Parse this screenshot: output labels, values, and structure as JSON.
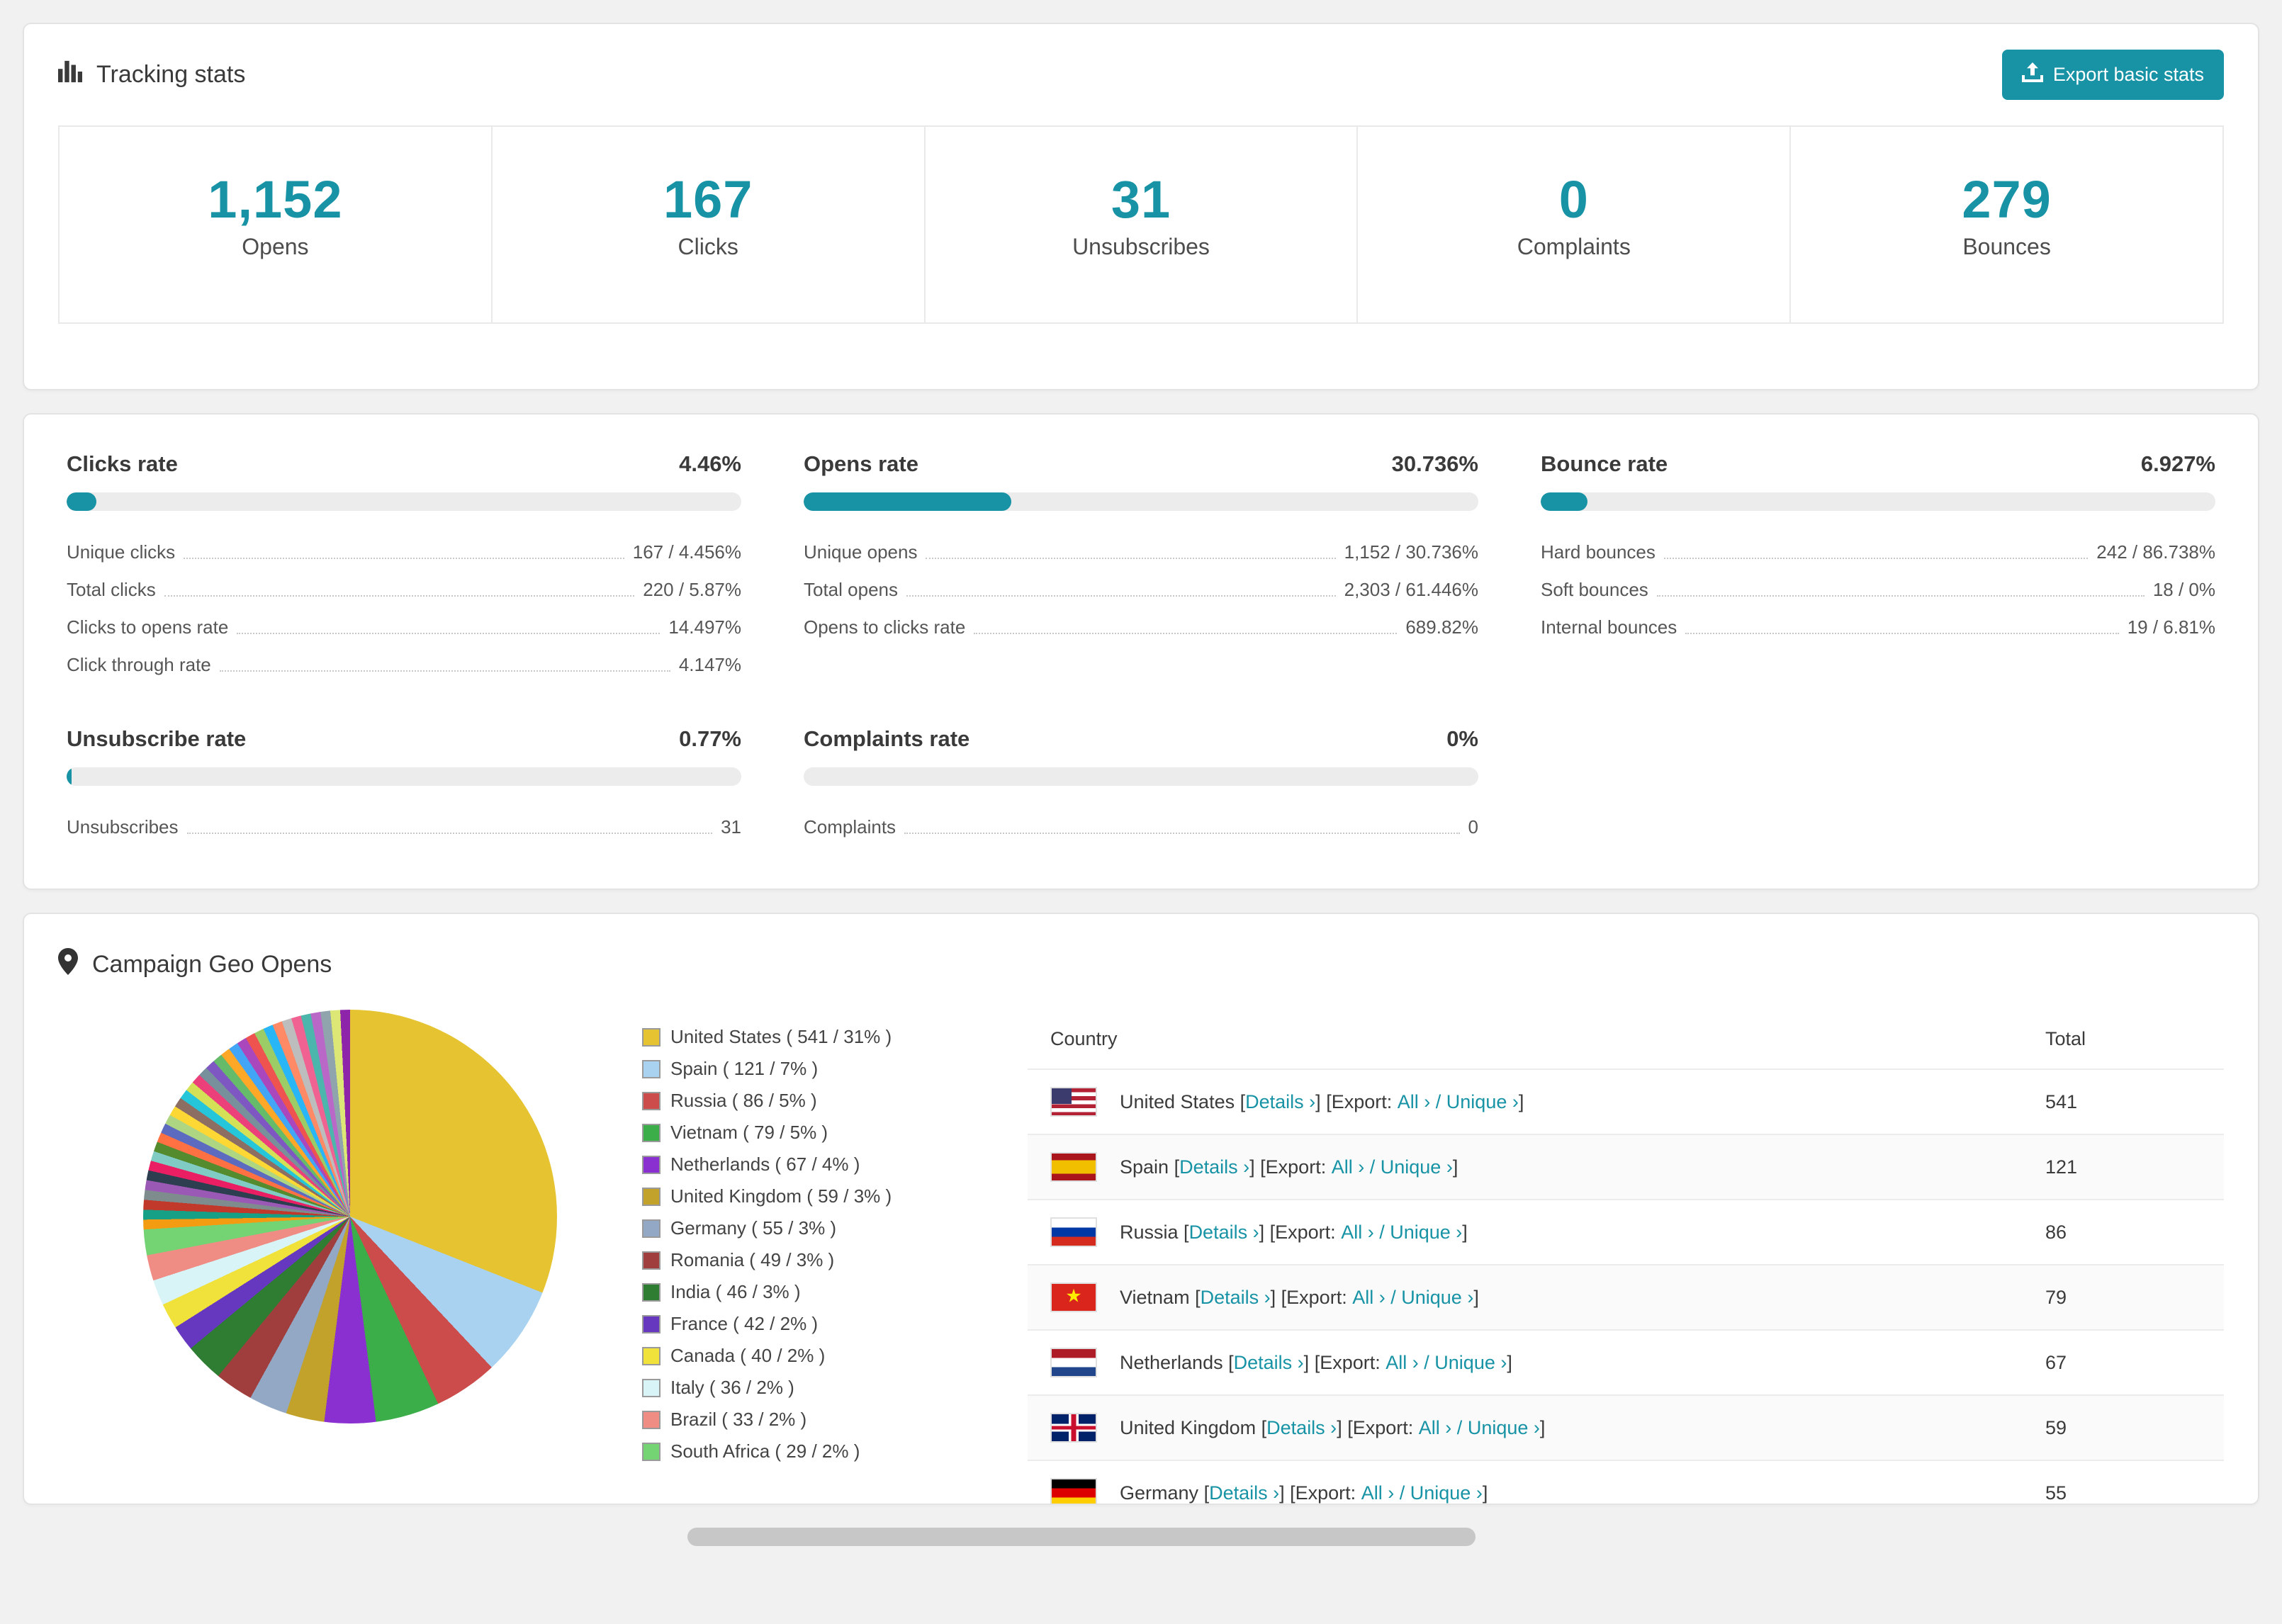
{
  "theme": {
    "accent": "#1793a5"
  },
  "tracking": {
    "title": "Tracking stats",
    "export_button": "Export basic stats",
    "stats": [
      {
        "value": "1,152",
        "label": "Opens"
      },
      {
        "value": "167",
        "label": "Clicks"
      },
      {
        "value": "31",
        "label": "Unsubscribes"
      },
      {
        "value": "0",
        "label": "Complaints"
      },
      {
        "value": "279",
        "label": "Bounces"
      }
    ]
  },
  "rates": [
    {
      "title": "Clicks rate",
      "value": "4.46%",
      "percent": 4.46,
      "rows": [
        {
          "label": "Unique clicks",
          "value": "167 / 4.456%"
        },
        {
          "label": "Total clicks",
          "value": "220 / 5.87%"
        },
        {
          "label": "Clicks to opens rate",
          "value": "14.497%"
        },
        {
          "label": "Click through rate",
          "value": "4.147%"
        }
      ]
    },
    {
      "title": "Opens rate",
      "value": "30.736%",
      "percent": 30.736,
      "rows": [
        {
          "label": "Unique opens",
          "value": "1,152 / 30.736%"
        },
        {
          "label": "Total opens",
          "value": "2,303 / 61.446%"
        },
        {
          "label": "Opens to clicks rate",
          "value": "689.82%"
        }
      ]
    },
    {
      "title": "Bounce rate",
      "value": "6.927%",
      "percent": 6.927,
      "rows": [
        {
          "label": "Hard bounces",
          "value": "242 / 86.738%"
        },
        {
          "label": "Soft bounces",
          "value": "18 / 0%"
        },
        {
          "label": "Internal bounces",
          "value": "19 / 6.81%"
        }
      ]
    },
    {
      "title": "Unsubscribe rate",
      "value": "0.77%",
      "percent": 0.77,
      "rows": [
        {
          "label": "Unsubscribes",
          "value": "31"
        }
      ]
    },
    {
      "title": "Complaints rate",
      "value": "0%",
      "percent": 0,
      "rows": [
        {
          "label": "Complaints",
          "value": "0"
        }
      ]
    }
  ],
  "geo": {
    "title": "Campaign Geo Opens",
    "labels": {
      "open": "[",
      "close": "]",
      "details": "Details ›",
      "export_open": "[Export:",
      "all": "All ›",
      "slash": "/",
      "unique": "Unique ›"
    },
    "table": {
      "country_header": "Country",
      "total_header": "Total"
    },
    "rows": [
      {
        "country": "United States",
        "flag": "us",
        "total": "541"
      },
      {
        "country": "Spain",
        "flag": "es",
        "total": "121"
      },
      {
        "country": "Russia",
        "flag": "ru",
        "total": "86"
      },
      {
        "country": "Vietnam",
        "flag": "vn",
        "total": "79"
      },
      {
        "country": "Netherlands",
        "flag": "nl",
        "total": "67"
      },
      {
        "country": "United Kingdom",
        "flag": "gb",
        "total": "59"
      },
      {
        "country": "Germany",
        "flag": "de",
        "total": "55"
      }
    ],
    "chart_data": {
      "type": "pie",
      "title": "Campaign Geo Opens",
      "legend_position": "right",
      "slices": [
        {
          "label": "United States",
          "value": 541,
          "pct": 31,
          "color": "#e6c431",
          "legend": "United States ( 541 / 31% )"
        },
        {
          "label": "Spain",
          "value": 121,
          "pct": 7,
          "color": "#a8d2f0",
          "legend": "Spain ( 121 / 7% )"
        },
        {
          "label": "Russia",
          "value": 86,
          "pct": 5,
          "color": "#cc4b4b",
          "legend": "Russia ( 86 / 5% )"
        },
        {
          "label": "Vietnam",
          "value": 79,
          "pct": 5,
          "color": "#3cae49",
          "legend": "Vietnam ( 79 / 5% )"
        },
        {
          "label": "Netherlands",
          "value": 67,
          "pct": 4,
          "color": "#8a2fd0",
          "legend": "Netherlands ( 67 / 4% )"
        },
        {
          "label": "United Kingdom",
          "value": 59,
          "pct": 3,
          "color": "#c3a22b",
          "legend": "United Kingdom ( 59 / 3% )"
        },
        {
          "label": "Germany",
          "value": 55,
          "pct": 3,
          "color": "#92a8c4",
          "legend": "Germany ( 55 / 3% )"
        },
        {
          "label": "Romania",
          "value": 49,
          "pct": 3,
          "color": "#a03e3e",
          "legend": "Romania ( 49 / 3% )"
        },
        {
          "label": "India",
          "value": 46,
          "pct": 3,
          "color": "#2e7d32",
          "legend": "India ( 46 / 3% )"
        },
        {
          "label": "France",
          "value": 42,
          "pct": 2,
          "color": "#6638c0",
          "legend": "France ( 42 / 2% )"
        },
        {
          "label": "Canada",
          "value": 40,
          "pct": 2,
          "color": "#f0e13b",
          "legend": "Canada ( 40 / 2% )"
        },
        {
          "label": "Italy",
          "value": 36,
          "pct": 2,
          "color": "#d9f4f6",
          "legend": "Italy ( 36 / 2% )"
        },
        {
          "label": "Brazil",
          "value": 33,
          "pct": 2,
          "color": "#ef8d85",
          "legend": "Brazil ( 33 / 2% )"
        },
        {
          "label": "South Africa",
          "value": 29,
          "pct": 2,
          "color": "#74d474",
          "legend": "South Africa ( 29 / 2% )"
        }
      ],
      "other_colors": [
        "#f39c12",
        "#16a085",
        "#c0392b",
        "#7f8c8d",
        "#9b59b6",
        "#2c3e50",
        "#e91e63",
        "#80cbc4",
        "#558b2f",
        "#ff7043",
        "#5c6bc0",
        "#aed581",
        "#fdd835",
        "#8d6e63",
        "#26c6da",
        "#d4e157",
        "#ec407a",
        "#78909c",
        "#7e57c2",
        "#66bb6a",
        "#ffa726",
        "#42a5f5",
        "#ab47bc",
        "#ef5350",
        "#9ccc65",
        "#29b6f6",
        "#ff8a65",
        "#bdbdbd",
        "#f06292",
        "#4db6ac",
        "#ba68c8",
        "#90a4ae",
        "#dce775",
        "#8e24aa"
      ]
    }
  }
}
